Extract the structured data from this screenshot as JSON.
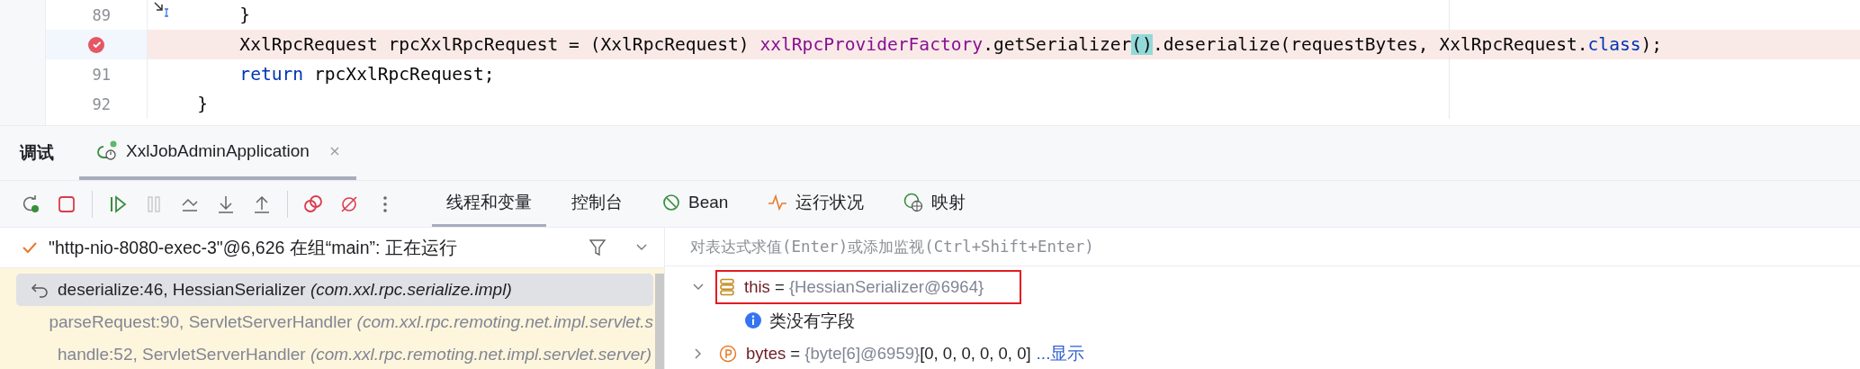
{
  "editor": {
    "lines": [
      {
        "number": "89",
        "breakpoint": false,
        "step_marker": true,
        "tokens": [
          {
            "text": "        }",
            "kind": "plain"
          }
        ]
      },
      {
        "breakpoint": true,
        "step_marker": false,
        "tokens": [
          {
            "text": "        XxlRpcRequest rpcXxlRpcRequest = (XxlRpcRequest) ",
            "kind": "plain"
          },
          {
            "text": "xxlRpcProviderFactory",
            "kind": "field"
          },
          {
            "text": ".getSerializer",
            "kind": "plain"
          },
          {
            "text": "()",
            "kind": "match"
          },
          {
            "text": ".deserialize(requestBytes, XxlRpcRequest.",
            "kind": "plain"
          },
          {
            "text": "class",
            "kind": "keyword"
          },
          {
            "text": ");",
            "kind": "plain"
          }
        ]
      },
      {
        "number": "91",
        "breakpoint": false,
        "step_marker": false,
        "tokens": [
          {
            "text": "        return",
            "kind": "keyword"
          },
          {
            "text": " rpcXxlRpcRequest;",
            "kind": "plain"
          }
        ]
      },
      {
        "number": "92",
        "breakpoint": false,
        "step_marker": false,
        "tokens": [
          {
            "text": "    }",
            "kind": "plain"
          }
        ]
      }
    ]
  },
  "debug": {
    "title": "调试",
    "session_tab": {
      "label": "XxlJobAdminApplication",
      "selected": true
    },
    "toolbar": [
      {
        "kind": "rerun",
        "disabled": false
      },
      {
        "kind": "stop",
        "disabled": false
      },
      {
        "kind": "resume",
        "disabled": false
      },
      {
        "kind": "pause",
        "disabled": true
      },
      {
        "kind": "step_over",
        "disabled": false
      },
      {
        "kind": "step_into",
        "disabled": false
      },
      {
        "kind": "step_out",
        "disabled": false
      },
      {
        "kind": "breakpoints",
        "disabled": false
      },
      {
        "kind": "mute",
        "disabled": false
      },
      {
        "kind": "more",
        "disabled": false
      }
    ],
    "tabs": [
      {
        "label": "线程和变量",
        "kind": "plain",
        "selected": true
      },
      {
        "label": "控制台",
        "kind": "plain",
        "selected": false
      },
      {
        "label": "Bean",
        "kind": "bean",
        "selected": false
      },
      {
        "label": "运行状况",
        "kind": "health",
        "selected": false
      },
      {
        "label": "映射",
        "kind": "mapping",
        "selected": false
      }
    ],
    "thread": {
      "text": "\"http-nio-8080-exec-3\"@6,626 在组“main”: 正在运行"
    },
    "frames": [
      {
        "method": "deserialize:46, HessianSerializer",
        "package": "(com.xxl.rpc.serialize.impl)",
        "selected": true
      },
      {
        "method": "parseRequest:90, ServletServerHandler",
        "package": "(com.xxl.rpc.remoting.net.impl.servlet.s",
        "selected": false
      },
      {
        "method": "handle:52, ServletServerHandler",
        "package": "(com.xxl.rpc.remoting.net.impl.servlet.server)",
        "selected": false
      }
    ],
    "evaluate": {
      "placeholder": "对表达式求值(Enter)或添加监视(Ctrl+Shift+Enter)"
    },
    "variables": [
      {
        "kind": "object",
        "name": "this",
        "sep": "=",
        "value": "{HessianSerializer@6964}",
        "expanded": true,
        "highlighted": true,
        "children": [
          {
            "kind": "info",
            "text": "类没有字段"
          }
        ]
      },
      {
        "kind": "param",
        "name": "bytes",
        "sep": "=",
        "value": "{byte[6]@6959}",
        "extra": "[0, 0, 0, 0, 0, 0]",
        "link": "...显示",
        "expanded": false,
        "highlighted": false
      }
    ]
  }
}
